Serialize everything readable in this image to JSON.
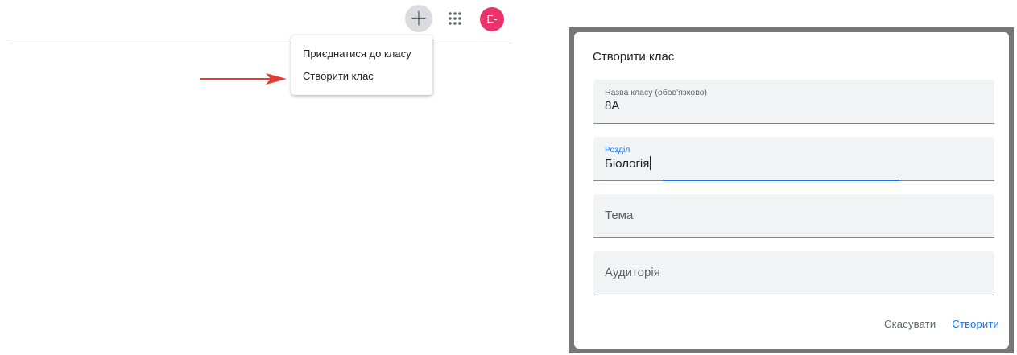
{
  "topbar": {
    "plus_icon": "+",
    "apps_icon": "apps-grid-icon",
    "avatar_initial": "E-"
  },
  "menu": {
    "items": [
      "Приєднатися до класу",
      "Створити клас"
    ]
  },
  "dialog": {
    "title": "Створити клас",
    "fields": [
      {
        "label": "Назва класу (обов'язково)",
        "value": "8A"
      },
      {
        "label": "Розділ",
        "value": "Біологія"
      },
      {
        "placeholder": "Тема"
      },
      {
        "placeholder": "Аудиторія"
      }
    ],
    "cancel_label": "Скасувати",
    "create_label": "Створити"
  },
  "colors": {
    "accent": "#1a73e8",
    "avatar": "#e8336d",
    "arrow": "#e53935"
  }
}
